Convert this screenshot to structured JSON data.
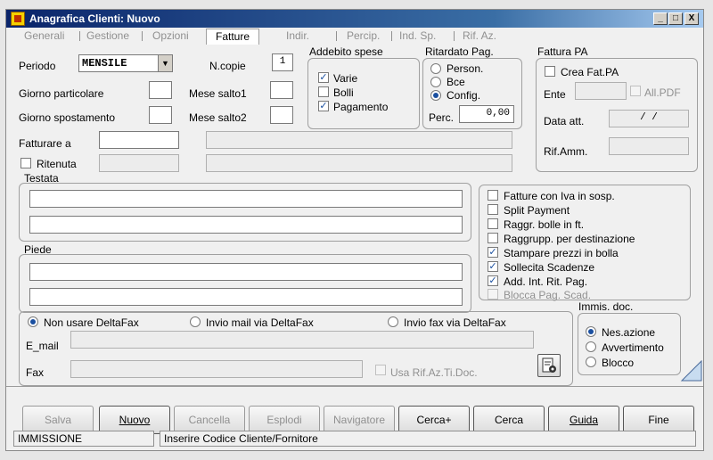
{
  "window": {
    "title": "Anagrafica Clienti: Nuovo",
    "minimize": "_",
    "restore": "□",
    "close": "X"
  },
  "tabs": [
    "Generali",
    "Gestione",
    "Opzioni",
    "Fatture",
    "Indir.",
    "Percip.",
    "Ind. Sp.",
    "Rif. Az."
  ],
  "periodo": {
    "label": "Periodo",
    "value": "MENSILE"
  },
  "ncopie": {
    "label": "N.copie",
    "value": "1"
  },
  "giorno_particolare": {
    "label": "Giorno particolare",
    "value": ""
  },
  "mese_salto1": {
    "label": "Mese salto1",
    "value": ""
  },
  "giorno_spostamento": {
    "label": "Giorno spostamento",
    "value": ""
  },
  "mese_salto2": {
    "label": "Mese salto2",
    "value": ""
  },
  "fatturare_a": {
    "label": "Fatturare a",
    "value": ""
  },
  "ritenuta": {
    "label": "Ritenuta",
    "checked": false
  },
  "addebito": {
    "title": "Addebito spese",
    "items": [
      {
        "label": "Varie",
        "checked": true
      },
      {
        "label": "Bolli",
        "checked": false
      },
      {
        "label": "Pagamento",
        "checked": true
      }
    ]
  },
  "ritardato": {
    "title": "Ritardato Pag.",
    "options": [
      "Person.",
      "Bce",
      "Config."
    ],
    "selected": 2,
    "perc_label": "Perc.",
    "perc_value": "0,00"
  },
  "fattura_pa": {
    "title": "Fattura PA",
    "crea_label": "Crea Fat.PA",
    "ente_label": "Ente",
    "all_pdf_label": "All.PDF",
    "data_att_label": "Data att.",
    "data_att_value": "/ /",
    "rif_amm_label": "Rif.Amm."
  },
  "testata": {
    "label": "Testata"
  },
  "piede": {
    "label": "Piede"
  },
  "options": [
    {
      "label": "Fatture con Iva in sosp.",
      "checked": false,
      "enabled": true
    },
    {
      "label": "Split Payment",
      "checked": false,
      "enabled": true
    },
    {
      "label": "Raggr. bolle in ft.",
      "checked": false,
      "enabled": true
    },
    {
      "label": "Raggrupp. per destinazione",
      "checked": false,
      "enabled": true
    },
    {
      "label": "Stampare prezzi in bolla",
      "checked": true,
      "enabled": true
    },
    {
      "label": "Sollecita Scadenze",
      "checked": true,
      "enabled": true
    },
    {
      "label": "Add. Int. Rit. Pag.",
      "checked": true,
      "enabled": true
    },
    {
      "label": "Blocca Pag. Scad.",
      "checked": false,
      "enabled": false
    }
  ],
  "deltafax": {
    "options": [
      "Non usare DeltaFax",
      "Invio mail via DeltaFax",
      "Invio fax via DeltaFax"
    ],
    "selected": 0,
    "email_label": "E_mail",
    "fax_label": "Fax",
    "usa_rif_label": "Usa Rif.Az.Ti.Doc."
  },
  "immis": {
    "title": "Immis. doc.",
    "options": [
      "Nes.azione",
      "Avvertimento",
      "Blocco"
    ],
    "selected": 0
  },
  "buttons": [
    {
      "label": "Salva",
      "enabled": false
    },
    {
      "label": "Nuovo",
      "enabled": true
    },
    {
      "label": "Cancella",
      "enabled": false
    },
    {
      "label": "Esplodi",
      "enabled": false
    },
    {
      "label": "Navigatore",
      "enabled": false
    },
    {
      "label": "Cerca+",
      "enabled": true
    },
    {
      "label": "Cerca",
      "enabled": true
    },
    {
      "label": "Guida",
      "enabled": true
    },
    {
      "label": "Fine",
      "enabled": true
    }
  ],
  "status": {
    "mode": "IMMISSIONE",
    "message": "Inserire Codice Cliente/Fornitore"
  }
}
